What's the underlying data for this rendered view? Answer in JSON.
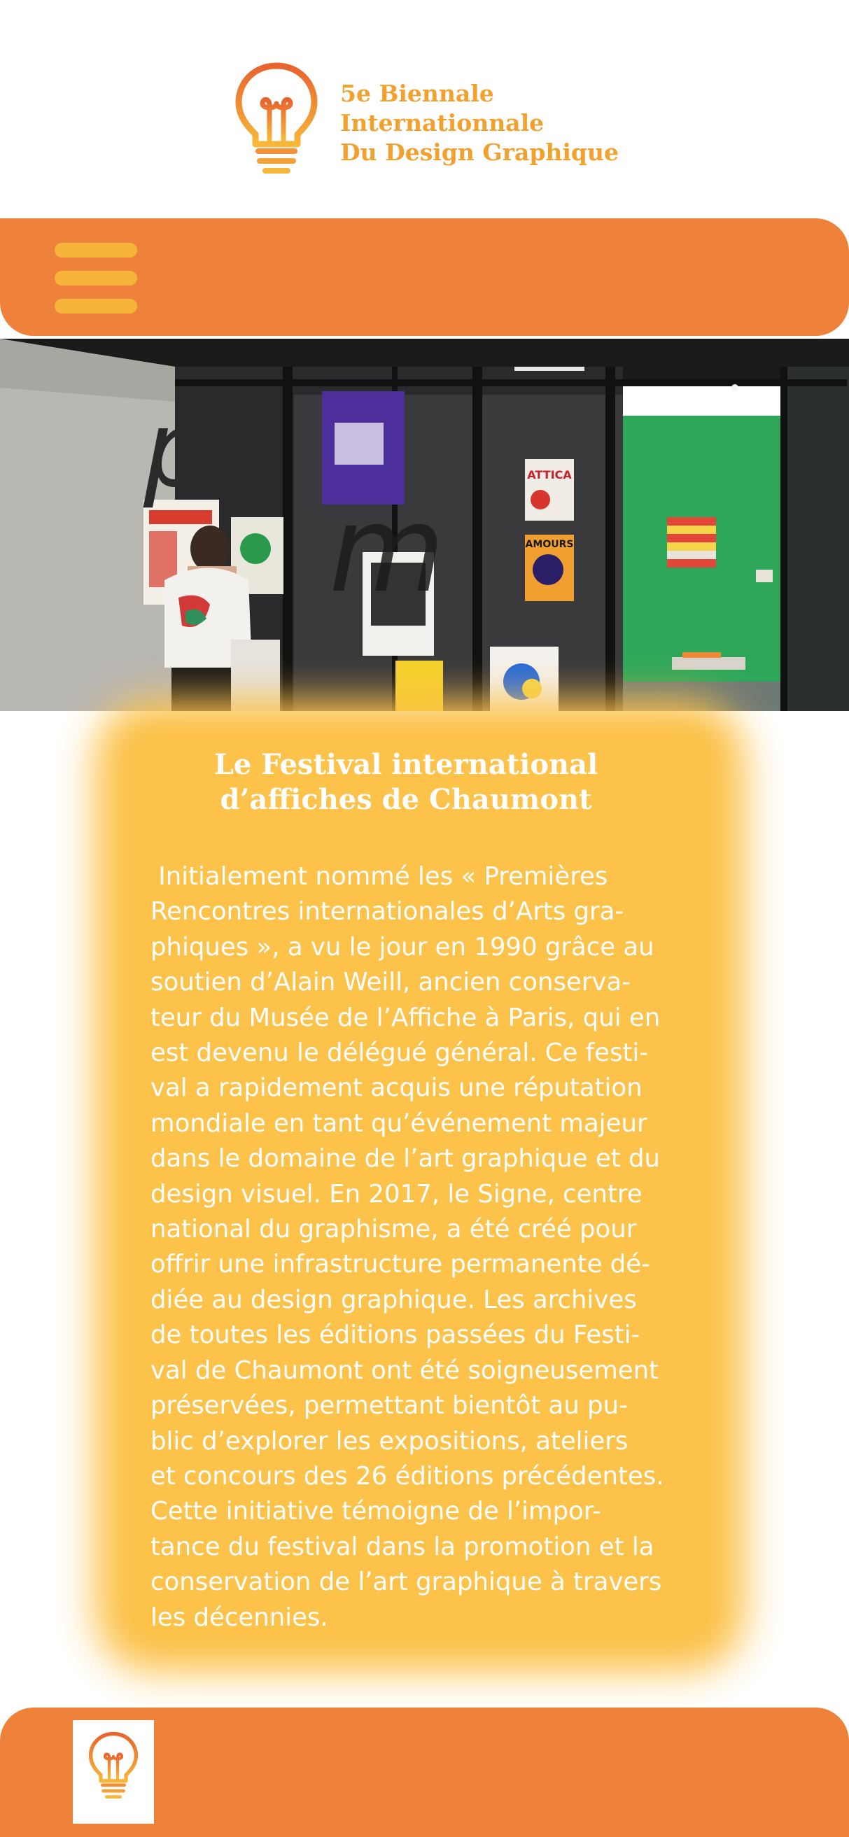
{
  "header": {
    "logo_lines": [
      "5e Biennale",
      "Internationnale",
      "Du Design Graphique"
    ],
    "logo_icon": "lightbulb-icon"
  },
  "nav": {
    "menu_icon": "hamburger-menu-icon"
  },
  "hero": {
    "poster_texts": [
      "ATTICA",
      "AMOURS"
    ]
  },
  "article": {
    "title_lines": [
      "Le Festival international",
      "d’affiches de Chaumont"
    ],
    "body": " Initialement nommé les « Premières\nRencontres internationales d’Arts gra-\nphiques », a vu le jour en 1990 grâce au\nsoutien d’Alain Weill, ancien conserva-\nteur du Musée de l’Affiche à Paris, qui en\nest devenu le délégué général. Ce festi-\nval a rapidement acquis une réputation\nmondiale en tant qu’événement majeur\ndans le domaine de l’art graphique et du\ndesign visuel. En 2017, le Signe, centre\nnational du graphisme, a été créé pour\noffrir une infrastructure permanente dé-\ndiée au design graphique. Les archives\nde toutes les éditions passées du Festi-\nval de Chaumont ont été soigneusement\npréservées, permettant bientôt au pu-\nblic d’explorer les expositions, ateliers\net concours des 26 éditions précédentes.\nCette initiative témoigne de l’impor-\ntance du festival dans la promotion et la\nconservation de l’art graphique à travers\nles décennies."
  },
  "footer": {
    "logo_icon": "lightbulb-icon"
  },
  "colors": {
    "orange": "#ee823a",
    "yellow": "#f7b43a",
    "glow": "#fcc24a",
    "logo_text": "#f2a02e"
  }
}
